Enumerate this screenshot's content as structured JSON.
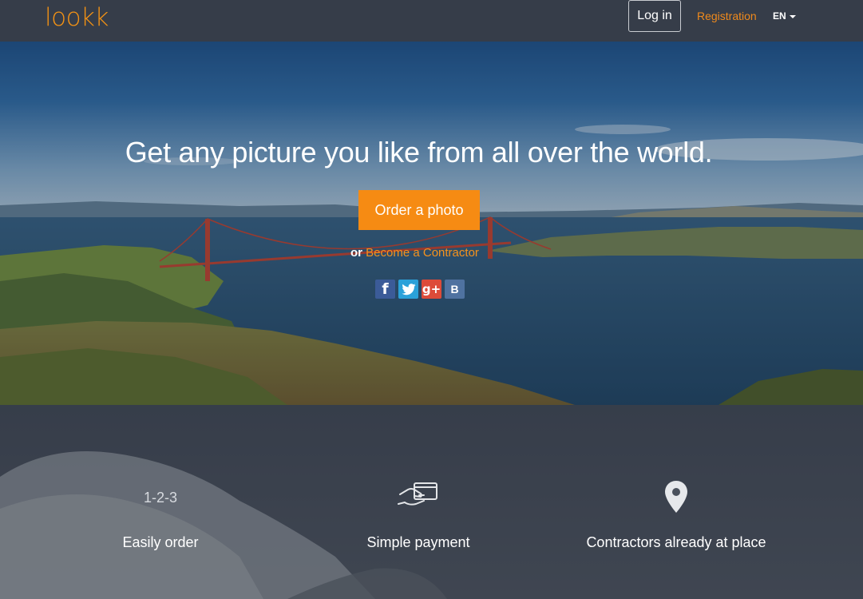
{
  "brand": {
    "logo_text": "lookk",
    "accent_color": "#f68b13"
  },
  "nav": {
    "login_label": "Log in",
    "registration_label": "Registration",
    "language_label": "EN"
  },
  "hero": {
    "title": "Get any picture you like from all over the world.",
    "order_button_label": "Order a photo",
    "or_text": "or",
    "contractor_link_label": "Become a Contractor",
    "socials": [
      {
        "name": "facebook",
        "glyph": "f"
      },
      {
        "name": "twitter",
        "glyph": ""
      },
      {
        "name": "google-plus",
        "glyph": "g+"
      },
      {
        "name": "vkontakte",
        "glyph": "B"
      }
    ]
  },
  "features": {
    "items": [
      {
        "icon": "1-2-3",
        "label": "Easily order"
      },
      {
        "icon": "card-in-hand-icon",
        "label": "Simple payment"
      },
      {
        "icon": "map-pin-icon",
        "label": "Contractors already at place"
      }
    ]
  }
}
